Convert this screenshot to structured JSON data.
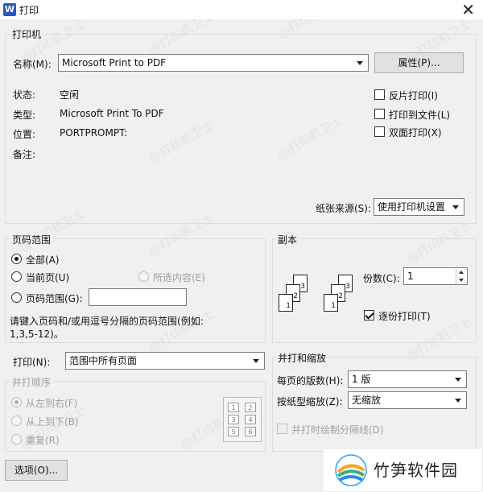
{
  "window": {
    "app_icon": "W",
    "title": "打印"
  },
  "printer": {
    "group_title": "打印机",
    "name_label": "名称(M):",
    "name_value": "Microsoft Print to PDF",
    "properties_button": "属性(P)...",
    "status_label": "状态:",
    "status_value": "空闲",
    "type_label": "类型:",
    "type_value": "Microsoft Print To PDF",
    "location_label": "位置:",
    "location_value": "PORTPROMPT:",
    "comment_label": "备注:",
    "options": [
      {
        "label": "反片打印(I)",
        "checked": false
      },
      {
        "label": "打印到文件(L)",
        "checked": false
      },
      {
        "label": "双面打印(X)",
        "checked": false
      }
    ],
    "paper_source_label": "纸张来源(S):",
    "paper_source_value": "使用打印机设置"
  },
  "page_range": {
    "group_title": "页码范围",
    "all": "全部(A)",
    "current": "当前页(U)",
    "selection": "所选内容(E)",
    "pages": "页码范围(G):",
    "hint_line1": "请键入页码和/或用逗号分隔的页码范围(例如:",
    "hint_line2": "1,3,5-12)。"
  },
  "copies": {
    "group_title": "副本",
    "count_label": "份数(C):",
    "count_value": "1",
    "collate_label": "逐份打印(T)",
    "collate_checked": true,
    "page_numbers": [
      "1",
      "2",
      "3"
    ]
  },
  "print_what": {
    "label": "打印(N):",
    "value": "范围中所有页面"
  },
  "order": {
    "group_title": "并打顺序",
    "left_to_right": "从左到右(F)",
    "top_to_bottom": "从上到下(B)",
    "repeat": "重复(R)",
    "preview_cells": [
      "1",
      "2",
      "3",
      "4",
      "5",
      "6"
    ]
  },
  "zoom": {
    "group_title": "并打和缩放",
    "pages_per_sheet_label": "每页的版数(H):",
    "pages_per_sheet_value": "1 版",
    "scale_label": "按纸型缩放(Z):",
    "scale_value": "无缩放",
    "draw_borders_label": "并打时绘制分隔线(D)"
  },
  "options_button": "选项(O)...",
  "watermark_text": "@打印机卫士",
  "logo_text": "竹笋软件园"
}
